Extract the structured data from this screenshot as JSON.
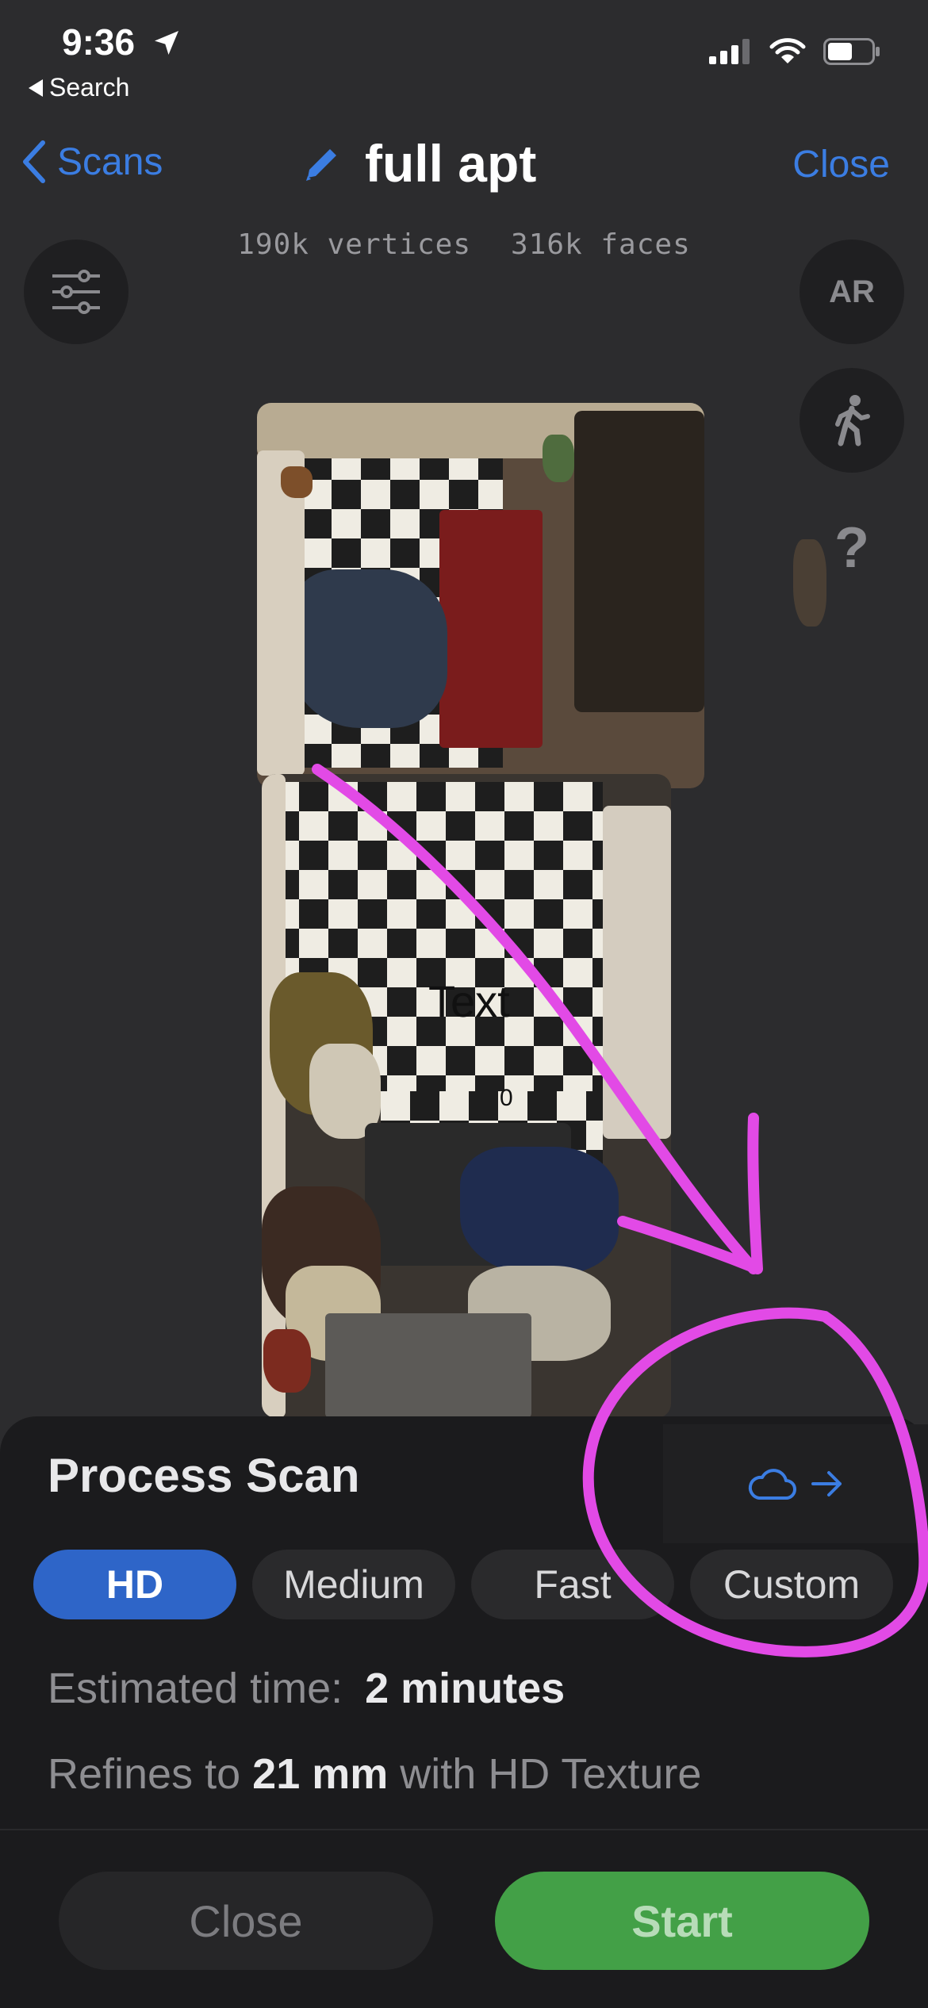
{
  "status_bar": {
    "time": "9:36",
    "back_app_label": "Search"
  },
  "nav": {
    "back_label": "Scans",
    "title": "full apt",
    "close_label": "Close"
  },
  "stats": {
    "vertices": "190k vertices",
    "faces": "316k faces"
  },
  "viewer": {
    "ar_label": "AR",
    "help_label": "?",
    "scan_text_label": "Text",
    "scan_zero_label": "0"
  },
  "sheet": {
    "title": "Process Scan",
    "segments": [
      {
        "label": "HD",
        "active": true
      },
      {
        "label": "Medium",
        "active": false
      },
      {
        "label": "Fast",
        "active": false
      },
      {
        "label": "Custom",
        "active": false
      }
    ],
    "estimated_label": "Estimated time:",
    "estimated_value": "2 minutes",
    "refine_prefix": "Refines to",
    "refine_value": "21 mm",
    "refine_suffix": "with HD Texture",
    "close_label": "Close",
    "start_label": "Start"
  },
  "colors": {
    "accent_blue": "#3b7de2",
    "selected_segment": "#2e65c8",
    "start_green": "#43a047",
    "annotation_magenta": "#e24ae6"
  }
}
